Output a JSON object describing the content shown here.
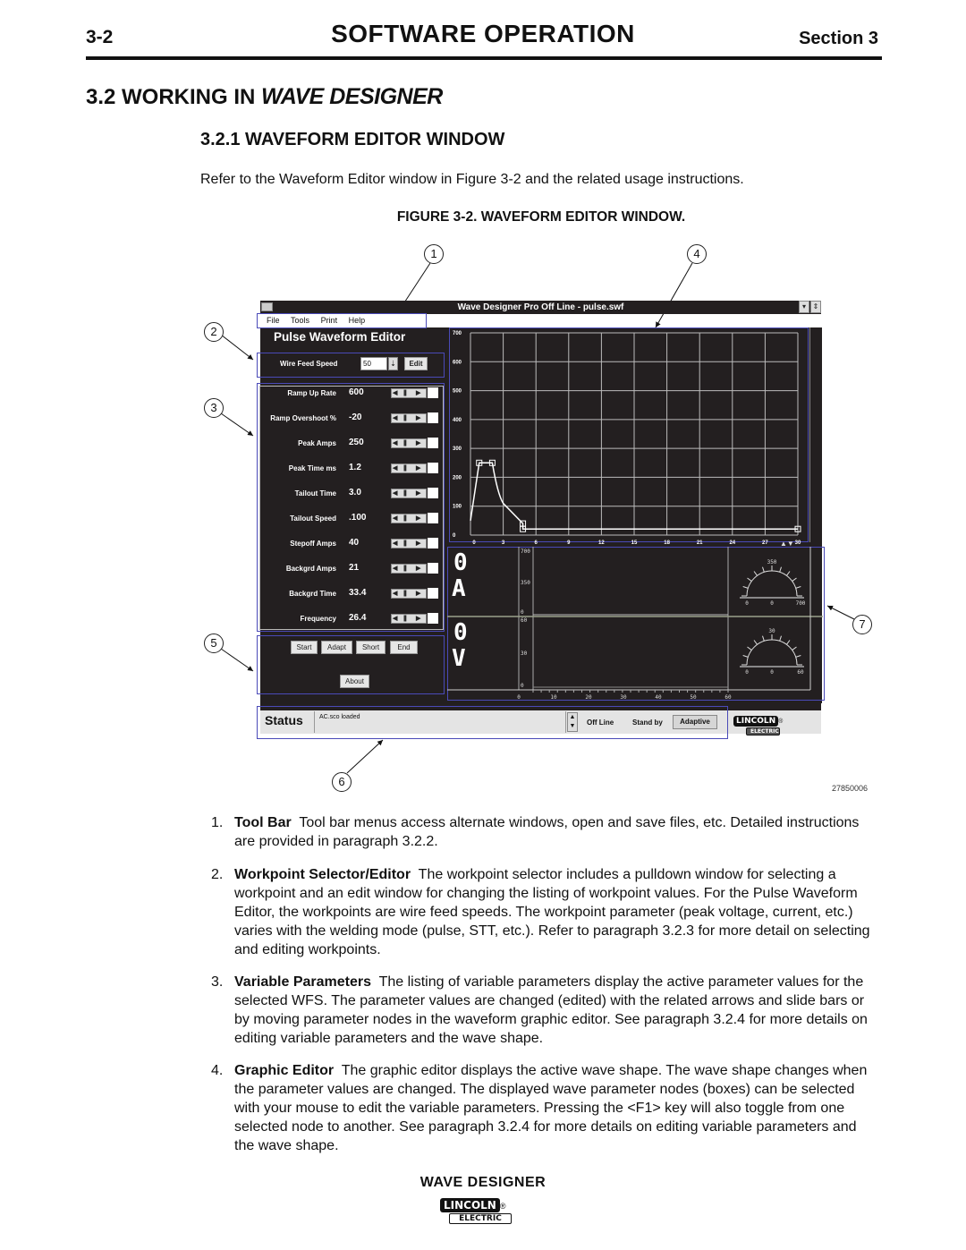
{
  "page_header": {
    "page_number": "3-2",
    "title": "SOFTWARE  OPERATION",
    "section": "Section 3"
  },
  "section_heading": {
    "prefix": "3.2 WORKING  IN",
    "brand": "WAVE DESIGNER"
  },
  "subsection_heading": "3.2.1 WAVEFORM  EDITOR  WINDOW",
  "intro_text": "Refer to the Waveform Editor window in Figure 3-2 and the related usage instructions.",
  "figure_caption": "FIGURE 3-2.  WAVEFORM EDITOR WINDOW.",
  "figure_id": "27850006",
  "callouts": [
    "1",
    "2",
    "3",
    "4",
    "5",
    "6",
    "7"
  ],
  "window": {
    "title": "Wave Designer Pro Off Line - pulse.swf",
    "menu": [
      "File",
      "Tools",
      "Print",
      "Help"
    ],
    "editor_title": "Pulse Waveform Editor",
    "workpoint": {
      "label": "Wire Feed Speed",
      "value": "50",
      "edit_label": "Edit"
    },
    "parameters": [
      {
        "label": "Ramp Up Rate",
        "value": "600"
      },
      {
        "label": "Ramp Overshoot %",
        "value": "-20"
      },
      {
        "label": "Peak Amps",
        "value": "250"
      },
      {
        "label": "Peak Time ms",
        "value": "1.2"
      },
      {
        "label": "Tailout Time",
        "value": "3.0"
      },
      {
        "label": "Tailout Speed",
        "value": ".100"
      },
      {
        "label": "Stepoff Amps",
        "value": "40"
      },
      {
        "label": "Backgrd Amps",
        "value": "21"
      },
      {
        "label": "Backgrd Time",
        "value": "33.4"
      },
      {
        "label": "Frequency",
        "value": "26.4"
      }
    ],
    "buttons": [
      "Start",
      "Adapt",
      "Short",
      "End"
    ],
    "about_label": "About",
    "status": {
      "label": "Status",
      "message": "AC.sco loaded",
      "mode": "Off Line",
      "state": "Stand by",
      "adaptive_label": "Adaptive"
    },
    "logo": {
      "top": "LINCOLN",
      "bottom": "ELECTRIC",
      "mark": "®"
    },
    "meters": {
      "amps_readout": "0",
      "amps_unit": "A",
      "volts_readout": "0",
      "volts_unit": "V",
      "amps_axis_ticks": [
        "700",
        "350",
        "0"
      ],
      "volts_axis_ticks": [
        "60",
        "30",
        "0"
      ],
      "time_axis_ticks": [
        "0",
        "10",
        "20",
        "30",
        "40",
        "50",
        "60"
      ],
      "amps_gauge": {
        "top": "350",
        "left": "0",
        "center": "0",
        "right": "700"
      },
      "volts_gauge": {
        "top": "30",
        "left": "0",
        "center": "0",
        "right": "60"
      }
    }
  },
  "chart_data": {
    "type": "line",
    "title": "",
    "xlabel": "",
    "ylabel": "",
    "xlim": [
      0,
      30
    ],
    "ylim": [
      0,
      700
    ],
    "x_ticks": [
      "0",
      "3",
      "6",
      "9",
      "12",
      "15",
      "18",
      "21",
      "24",
      "27",
      "30"
    ],
    "y_ticks": [
      "0",
      "100",
      "200",
      "300",
      "400",
      "500",
      "600",
      "700"
    ],
    "grid": true,
    "series": [
      {
        "name": "waveform",
        "points": [
          [
            0,
            50
          ],
          [
            0.8,
            250
          ],
          [
            2.0,
            250
          ],
          [
            3.0,
            110
          ],
          [
            4.8,
            40
          ],
          [
            4.8,
            21
          ],
          [
            30,
            21
          ]
        ]
      }
    ],
    "nodes": [
      [
        0.8,
        250
      ],
      [
        2.0,
        250
      ],
      [
        4.8,
        40
      ],
      [
        4.8,
        21
      ],
      [
        30,
        21
      ]
    ]
  },
  "descriptions": [
    {
      "num": "1.",
      "title": "Tool Bar",
      "text": "Tool bar menus access alternate windows, open and save files, etc. Detailed instructions are provided in paragraph 3.2.2."
    },
    {
      "num": "2.",
      "title": "Workpoint Selector/Editor",
      "text": "The workpoint selector includes a pulldown window for selecting a workpoint and an edit window for changing the listing of workpoint values. For the Pulse Waveform Editor, the workpoints are wire feed speeds. The workpoint parameter (peak voltage, current, etc.) varies with the welding mode (pulse,  STT, etc.). Refer to paragraph 3.2.3 for more detail on selecting and editing workpoints."
    },
    {
      "num": "3.",
      "title": "Variable Parameters",
      "text": "The listing of variable parameters display the active parameter values for the selected WFS. The parameter values are changed (edited) with the related arrows and slide bars or by moving parameter nodes in the waveform graphic editor. See paragraph 3.2.4 for more details on editing variable parameters and the wave shape."
    },
    {
      "num": "4.",
      "title": "Graphic Editor",
      "text": "The graphic editor displays the active wave shape. The wave shape changes when the parameter values are changed. The displayed wave parameter nodes (boxes) can be selected with your mouse to edit the variable parameters.  Pressing the <F1> key will also toggle from one selected node to another.  See paragraph 3.2.4 for more details on editing variable parameters and the wave shape."
    }
  ],
  "footer": {
    "title": "WAVE  DESIGNER",
    "logo_top": "LINCOLN",
    "logo_bottom": "ELECTRIC",
    "logo_mark": "®"
  }
}
